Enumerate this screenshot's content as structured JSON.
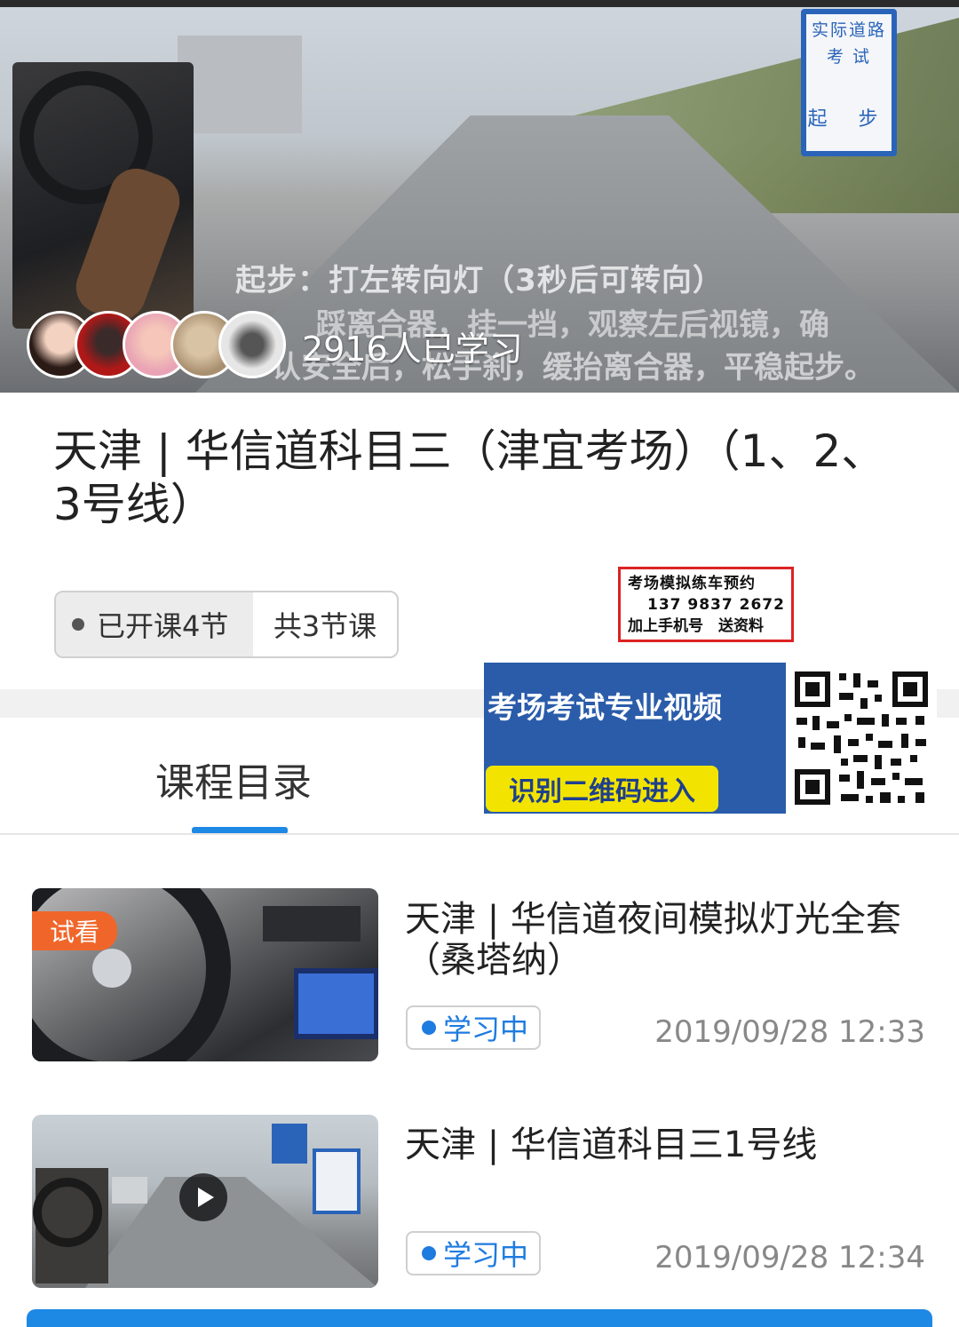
{
  "video": {
    "sign_line1": "实际道路",
    "sign_line2": "考 试",
    "sign_line3": "起 步",
    "caption_line1": "起步：打左转向灯（3秒后可转向）",
    "caption_line2": "踩离合器，挂一挡，观察左后视镜，确",
    "caption_line3": "认安全后，松手刹，缓抬离合器，平稳起步。",
    "learners": "2916人已学习"
  },
  "course": {
    "title": "天津 | 华信道科目三（津宜考场）（1、2、3号线）",
    "opened": "已开课4节",
    "total": "共3节课"
  },
  "promo": {
    "line1": "考场模拟练车预约",
    "line2": "137 9837 2672",
    "line3": "加上手机号　送资料"
  },
  "banner": {
    "headline": "考场考试专业视频",
    "button": "识别二维码进入"
  },
  "catalog": {
    "tab": "课程目录"
  },
  "lessons": [
    {
      "title": "天津 | 华信道夜间模拟灯光全套（桑塔纳）",
      "badge": "试看",
      "status": "学习中",
      "date": "2019/09/28 12:33"
    },
    {
      "title": "天津 | 华信道科目三1号线",
      "status": "学习中",
      "date": "2019/09/28 12:34"
    }
  ],
  "colors": {
    "accent": "#1e88e5",
    "trial_badge": "#f0662a",
    "banner_bg": "#2a5caa",
    "banner_button": "#f2e400",
    "promo_border": "#dd2222"
  }
}
